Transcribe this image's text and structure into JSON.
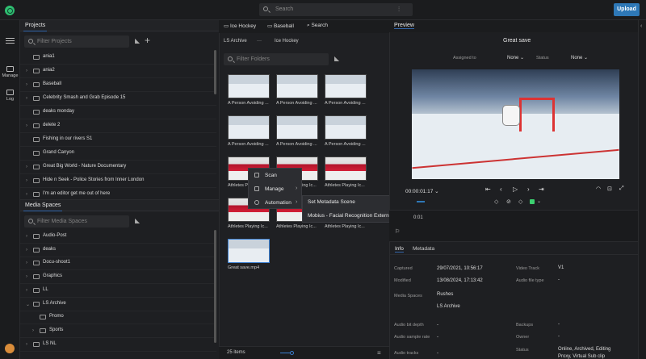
{
  "colors": {
    "accent": "#2e78b7",
    "brand": "#2fbf71",
    "bg": "#1b1c1e"
  },
  "top": {
    "search_placeholder": "Search",
    "upload_label": "Upload"
  },
  "rail": {
    "manage_label": "Manage",
    "log_label": "Log"
  },
  "projects": {
    "title": "Projects",
    "filter_placeholder": "Filter Projects",
    "items": [
      {
        "label": "ania1",
        "expandable": false
      },
      {
        "label": "ania2",
        "expandable": true
      },
      {
        "label": "Baseball",
        "expandable": true
      },
      {
        "label": "Celebrity Smash and Grab Episode 15",
        "expandable": true
      },
      {
        "label": "deaks monday",
        "expandable": false
      },
      {
        "label": "delete 2",
        "expandable": true
      },
      {
        "label": "Fishing in our rivers S1",
        "expandable": false
      },
      {
        "label": "Grand Canyon",
        "expandable": false
      },
      {
        "label": "Great Big World - Nature Documentary",
        "expandable": true
      },
      {
        "label": "Hide n Seek - Police Stories from Inner London",
        "expandable": true
      },
      {
        "label": "I'm an editor get me out of here",
        "expandable": true
      }
    ]
  },
  "media_spaces": {
    "title": "Media Spaces",
    "filter_placeholder": "Filter Media Spaces",
    "items": [
      {
        "label": "Audio-Post"
      },
      {
        "label": "deaks"
      },
      {
        "label": "Docu-shoot1"
      },
      {
        "label": "Graphics"
      },
      {
        "label": "LL"
      },
      {
        "label": "LS Archive"
      },
      {
        "label": "Promo"
      },
      {
        "label": "Sports"
      },
      {
        "label": "LS NL"
      }
    ]
  },
  "browser": {
    "tabs": [
      "Ice Hockey",
      "Baseball",
      "Search"
    ],
    "breadcrumb": [
      "LS Archive",
      "···",
      "Ice Hockey"
    ],
    "filter_placeholder": "Filter Folders",
    "thumbs": [
      {
        "caption": "A Person Avoiding ...",
        "kind": "ice"
      },
      {
        "caption": "A Person Avoiding ...",
        "kind": "ice"
      },
      {
        "caption": "A Person Avoiding ...",
        "kind": "ice"
      },
      {
        "caption": "A Person Avoiding ...",
        "kind": "ice"
      },
      {
        "caption": "A Person Avoiding ...",
        "kind": "ice"
      },
      {
        "caption": "A Person Avoiding ...",
        "kind": "ice"
      },
      {
        "caption": "Athletes Playing Ic...",
        "kind": "red"
      },
      {
        "caption": "Athletes Playing Ic...",
        "kind": "red"
      },
      {
        "caption": "Athletes Playing Ic...",
        "kind": "red"
      },
      {
        "caption": "Athletes Playing Ic...",
        "kind": "red"
      },
      {
        "caption": "Athletes Playing Ic...",
        "kind": "red"
      },
      {
        "caption": "Athletes Playing Ic...",
        "kind": "red"
      },
      {
        "caption": "Great save.mp4",
        "kind": "ice"
      }
    ],
    "item_count": "25 items"
  },
  "context_menu": {
    "items": [
      "Scan",
      "Manage",
      "Automation"
    ],
    "submenu": [
      "Set Metadata Scene",
      "Mobius - Facial Recognition External Trigger"
    ]
  },
  "preview": {
    "tab": "Preview",
    "title": "Great save",
    "assigned_label": "Assigned to",
    "assigned_value": "None",
    "status_label": "Status",
    "status_value": "None",
    "timecode": "00:00:01:17",
    "timeline_tick": "0:01"
  },
  "info": {
    "tabs": [
      "Info",
      "Metadata"
    ],
    "left": [
      {
        "label": "Captured",
        "value": "29/07/2021, 10:56:17"
      },
      {
        "label": "Modified",
        "value": "13/08/2024, 17:13:42"
      },
      {
        "label": "Media Spaces",
        "value": "Rushes"
      },
      {
        "label": "",
        "value": "LS Archive"
      },
      {
        "label": "Audio bit depth",
        "value": "-"
      },
      {
        "label": "Audio sample rate",
        "value": "-"
      },
      {
        "label": "Audio tracks",
        "value": "-"
      }
    ],
    "right": [
      {
        "label": "Video Track",
        "value": "V1"
      },
      {
        "label": "Audio file type",
        "value": "-"
      },
      {
        "label": "Backups",
        "value": "-"
      },
      {
        "label": "Owner",
        "value": "-"
      },
      {
        "label": "Status",
        "value": "Online, Archived, Editing"
      },
      {
        "label": "",
        "value": "Proxy, Virtual Sub clip"
      }
    ]
  }
}
